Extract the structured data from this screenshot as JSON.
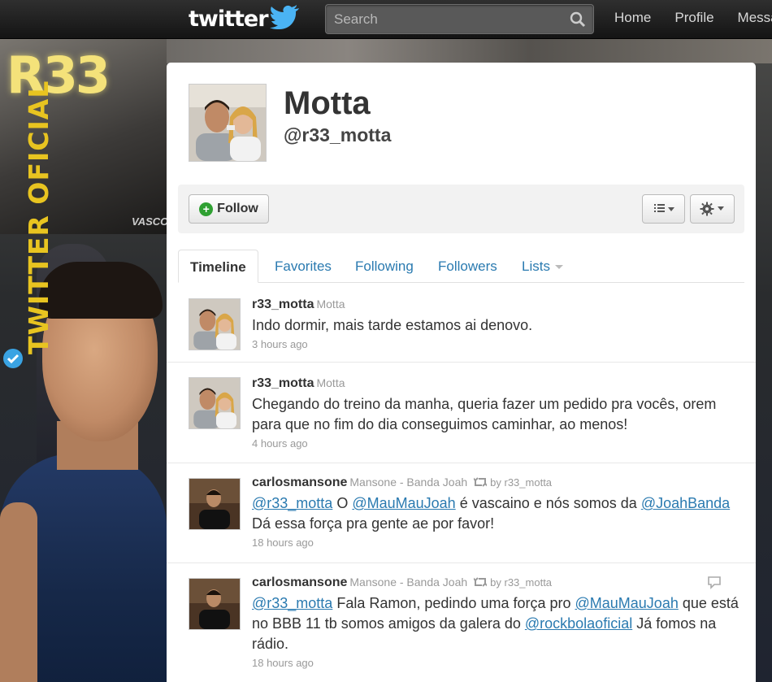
{
  "topbar": {
    "logo_text": "twitter",
    "search_placeholder": "Search",
    "nav": [
      "Home",
      "Profile",
      "Messages"
    ]
  },
  "background": {
    "banner_text": "TWITTER OFICIAL",
    "logo_text": "R33",
    "shirt_text": "VASCO"
  },
  "profile": {
    "name": "Motta",
    "handle": "@r33_motta"
  },
  "actions": {
    "follow_label": "Follow",
    "list_icon": "list-icon",
    "gear_icon": "gear-icon"
  },
  "tabs": [
    {
      "label": "Timeline",
      "active": true
    },
    {
      "label": "Favorites"
    },
    {
      "label": "Following"
    },
    {
      "label": "Followers"
    },
    {
      "label": "Lists"
    }
  ],
  "tweets": [
    {
      "user": "r33_motta",
      "fullname": "Motta",
      "retweet_by": "",
      "segments": [
        {
          "t": "Indo dormir, mais tarde estamos ai denovo."
        }
      ],
      "time": "3 hours ago"
    },
    {
      "user": "r33_motta",
      "fullname": "Motta",
      "retweet_by": "",
      "segments": [
        {
          "t": "Chegando do treino da manha, queria fazer um pedido pra vocês, orem para que no fim do dia conseguimos caminhar, ao menos!"
        }
      ],
      "time": "4 hours ago"
    },
    {
      "user": "carlosmansone",
      "fullname": "Mansone - Banda Joah",
      "retweet_by": "by r33_motta",
      "segments": [
        {
          "t": "@r33_motta",
          "mention": true
        },
        {
          "t": " O "
        },
        {
          "t": "@MauMauJoah",
          "mention": true
        },
        {
          "t": " é vascaino e nós somos da "
        },
        {
          "t": "@JoahBanda",
          "mention": true
        },
        {
          "t": " Dá essa força pra gente ae por favor!"
        }
      ],
      "time": "18 hours ago"
    },
    {
      "user": "carlosmansone",
      "fullname": "Mansone - Banda Joah",
      "retweet_by": "by r33_motta",
      "segments": [
        {
          "t": "@r33_motta",
          "mention": true
        },
        {
          "t": " Fala Ramon, pedindo uma força pro "
        },
        {
          "t": "@MauMauJoah",
          "mention": true
        },
        {
          "t": " que está no BBB 11 tb somos amigos da galera do "
        },
        {
          "t": "@rockbolaoficial",
          "mention": true
        },
        {
          "t": " Já fomos na rádio."
        }
      ],
      "time": "18 hours ago"
    }
  ]
}
